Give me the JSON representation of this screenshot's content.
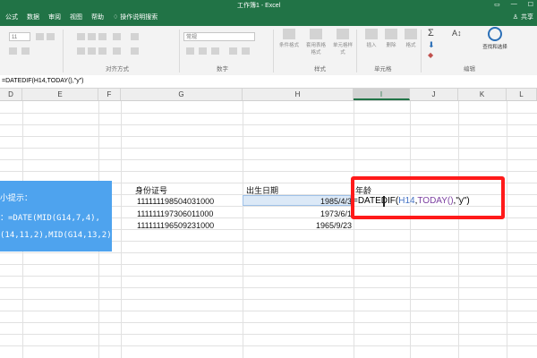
{
  "window": {
    "title": "工作簿1 - Excel",
    "share_label": "共享"
  },
  "tabs": [
    "公式",
    "数据",
    "审阅",
    "视图",
    "帮助",
    "操作说明搜索"
  ],
  "ribbon": {
    "font_size": "11",
    "number_format": "常规",
    "groups": [
      "对齐方式",
      "数字",
      "样式",
      "单元格",
      "编辑"
    ],
    "buttons": [
      "条件格式",
      "套用表格格式",
      "单元格样式",
      "插入",
      "删除",
      "格式",
      "查找和选择"
    ]
  },
  "formula_bar": {
    "content": "=DATEDIF(H14,TODAY(),\"y\")"
  },
  "columns": [
    "D",
    "E",
    "F",
    "G",
    "H",
    "I",
    "J",
    "K",
    "L"
  ],
  "active_column": "I",
  "headers": {
    "id": "身份证号",
    "birth": "出生日期",
    "age": "年龄"
  },
  "rows": [
    {
      "id": "111111198504031000",
      "birth": "1985/4/3"
    },
    {
      "id": "111111197306011000",
      "birth": "1973/6/1"
    },
    {
      "id": "111111196509231000",
      "birth": "1965/9/23"
    }
  ],
  "cell_formula": {
    "prefix": "=DATEDIF(",
    "ref": "H14",
    "comma": ",",
    "fn": "TODAY()",
    "suffix": ",\"y\")"
  },
  "tip": {
    "title": "小提示：",
    "line1": "：=DATE(MID(G14,7,4),",
    "line2": "(14,11,2),MID(G14,13,2)"
  },
  "colors": {
    "excel_green": "#217346",
    "tip_bg": "#4ea3ee",
    "annotation_red": "#ff1a1a",
    "reference_blue": "#4472c4"
  }
}
